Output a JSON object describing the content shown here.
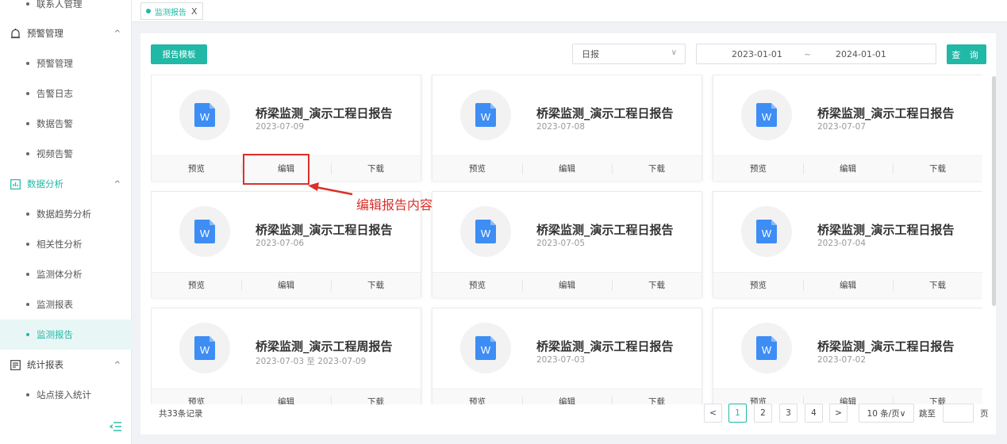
{
  "sidebar": {
    "items": [
      {
        "type": "item",
        "label": "联系人管理",
        "active": false
      },
      {
        "type": "group",
        "label": "预警管理",
        "icon": "alarm-icon"
      },
      {
        "type": "item",
        "label": "预警管理",
        "active": false
      },
      {
        "type": "item",
        "label": "告警日志",
        "active": false
      },
      {
        "type": "item",
        "label": "数据告警",
        "active": false
      },
      {
        "type": "item",
        "label": "视频告警",
        "active": false
      },
      {
        "type": "group",
        "label": "数据分析",
        "icon": "chart-icon"
      },
      {
        "type": "item",
        "label": "数据趋势分析",
        "active": false
      },
      {
        "type": "item",
        "label": "相关性分析",
        "active": false
      },
      {
        "type": "item",
        "label": "监测体分析",
        "active": false
      },
      {
        "type": "item",
        "label": "监测报表",
        "active": false
      },
      {
        "type": "item",
        "label": "监测报告",
        "active": true
      },
      {
        "type": "group",
        "label": "统计报表",
        "icon": "report-icon"
      },
      {
        "type": "item",
        "label": "站点接入统计",
        "active": false
      }
    ],
    "group_caret": "^",
    "collapse_icon": "menu-fold-icon"
  },
  "tabs": [
    {
      "label": "监测报告",
      "close": "X"
    }
  ],
  "toolbar": {
    "template_button": "报告模板",
    "report_type": "日报",
    "date_start": "2023-01-01",
    "date_sep": "~",
    "date_end": "2024-01-01",
    "query_button": "查 询"
  },
  "cards": [
    {
      "title": "桥梁监测_演示工程日报告",
      "date": "2023-07-09"
    },
    {
      "title": "桥梁监测_演示工程日报告",
      "date": "2023-07-08"
    },
    {
      "title": "桥梁监测_演示工程日报告",
      "date": "2023-07-07"
    },
    {
      "title": "桥梁监测_演示工程日报告",
      "date": "2023-07-06"
    },
    {
      "title": "桥梁监测_演示工程日报告",
      "date": "2023-07-05"
    },
    {
      "title": "桥梁监测_演示工程日报告",
      "date": "2023-07-04"
    },
    {
      "title": "桥梁监测_演示工程周报告",
      "date": "2023-07-03 至 2023-07-09"
    },
    {
      "title": "桥梁监测_演示工程日报告",
      "date": "2023-07-03"
    },
    {
      "title": "桥梁监测_演示工程日报告",
      "date": "2023-07-02"
    }
  ],
  "card_actions": {
    "preview": "预览",
    "edit": "编辑",
    "download": "下载"
  },
  "file_icon_letter": "W",
  "annotation": "编辑报告内容",
  "pagination": {
    "total": "共33条记录",
    "prev": "<",
    "pages": [
      "1",
      "2",
      "3",
      "4"
    ],
    "current": "1",
    "next": ">",
    "page_size": "10 条/页∨",
    "jump_label": "跳至",
    "page_label": "页"
  },
  "colors": {
    "accent": "#22b8a6",
    "annotation": "#d9312b",
    "word_icon": "#3d8df5"
  }
}
